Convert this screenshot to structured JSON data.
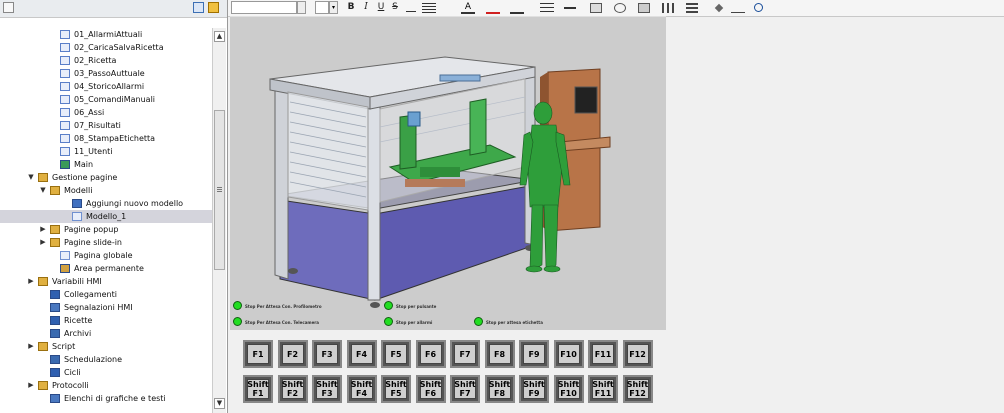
{
  "tree": {
    "items": [
      {
        "label": "01_AllarmiAttuali",
        "level": 5,
        "icon": "screen-icon"
      },
      {
        "label": "02_CaricaSalvaRicetta",
        "level": 5,
        "icon": "screen-icon"
      },
      {
        "label": "02_Ricetta",
        "level": 5,
        "icon": "screen-icon"
      },
      {
        "label": "03_PassoAuttuale",
        "level": 5,
        "icon": "screen-icon"
      },
      {
        "label": "04_StoricoAllarmi",
        "level": 5,
        "icon": "screen-icon"
      },
      {
        "label": "05_ComandiManuali",
        "level": 5,
        "icon": "screen-icon"
      },
      {
        "label": "06_Assi",
        "level": 5,
        "icon": "screen-icon"
      },
      {
        "label": "07_Risultati",
        "level": 5,
        "icon": "screen-icon"
      },
      {
        "label": "08_StampaEtichetta",
        "level": 5,
        "icon": "screen-icon"
      },
      {
        "label": "11_Utenti",
        "level": 5,
        "icon": "screen-icon"
      },
      {
        "label": "Main",
        "level": 5,
        "icon": "main-screen-icon"
      },
      {
        "label": "Gestione pagine",
        "level": 3,
        "icon": "folder-icon",
        "expand": "open"
      },
      {
        "label": "Modelli",
        "level": 4,
        "icon": "folder-icon",
        "expand": "open"
      },
      {
        "label": "Aggiungi nuovo modello",
        "level": 6,
        "icon": "add-template-icon"
      },
      {
        "label": "Modello_1",
        "level": 6,
        "icon": "template-icon",
        "selected": true
      },
      {
        "label": "Pagine popup",
        "level": 4,
        "icon": "folder-icon",
        "expand": "closed"
      },
      {
        "label": "Pagine slide-in",
        "level": 4,
        "icon": "folder-icon",
        "expand": "closed"
      },
      {
        "label": "Pagina globale",
        "level": 5,
        "icon": "global-screen-icon"
      },
      {
        "label": "Area permanente",
        "level": 5,
        "icon": "permanent-area-icon"
      },
      {
        "label": "Variabili HMI",
        "level": 3,
        "icon": "folder-icon",
        "expand": "closed"
      },
      {
        "label": "Collegamenti",
        "level": 4,
        "icon": "connections-icon"
      },
      {
        "label": "Segnalazioni HMI",
        "level": 4,
        "icon": "alarms-icon"
      },
      {
        "label": "Ricette",
        "level": 4,
        "icon": "recipes-icon"
      },
      {
        "label": "Archivi",
        "level": 4,
        "icon": "archives-icon"
      },
      {
        "label": "Script",
        "level": 3,
        "icon": "folder-icon",
        "expand": "closed"
      },
      {
        "label": "Schedulazione",
        "level": 4,
        "icon": "scheduler-icon"
      },
      {
        "label": "Cicli",
        "level": 4,
        "icon": "cycles-icon"
      },
      {
        "label": "Protocolli",
        "level": 3,
        "icon": "folder-icon",
        "expand": "closed"
      },
      {
        "label": "Elenchi di grafiche e testi",
        "level": 4,
        "icon": "lists-icon"
      }
    ]
  },
  "leds": [
    {
      "label": "Stop Per Attesa Con. Profilometro"
    },
    {
      "label": "Stop Per Attesa Con. Telecamera"
    },
    {
      "label": "Stop per pulsante"
    },
    {
      "label": "Stop per allarmi"
    },
    {
      "label": "Stop per attesa etichetta"
    }
  ],
  "fkeys_row1": [
    "F1",
    "F2",
    "F3",
    "F4",
    "F5",
    "F6",
    "F7",
    "F8",
    "F9",
    "F10",
    "F11",
    "F12"
  ],
  "fkeys_row2": [
    "Shift\nF1",
    "Shift\nF2",
    "Shift\nF3",
    "Shift\nF4",
    "Shift\nF5",
    "Shift\nF6",
    "Shift\nF7",
    "Shift\nF8",
    "Shift\nF9",
    "Shift\nF10",
    "Shift\nF11",
    "Shift\nF12"
  ],
  "toolbar": {
    "bold": "B",
    "italic": "I",
    "underline": "U",
    "strike": "S"
  },
  "colors": {
    "accent": "#3c6fb4",
    "panel": "#cccccc",
    "led": "#22dd22",
    "machine_side": "#6e6cbc",
    "human": "#2e9e3a"
  }
}
